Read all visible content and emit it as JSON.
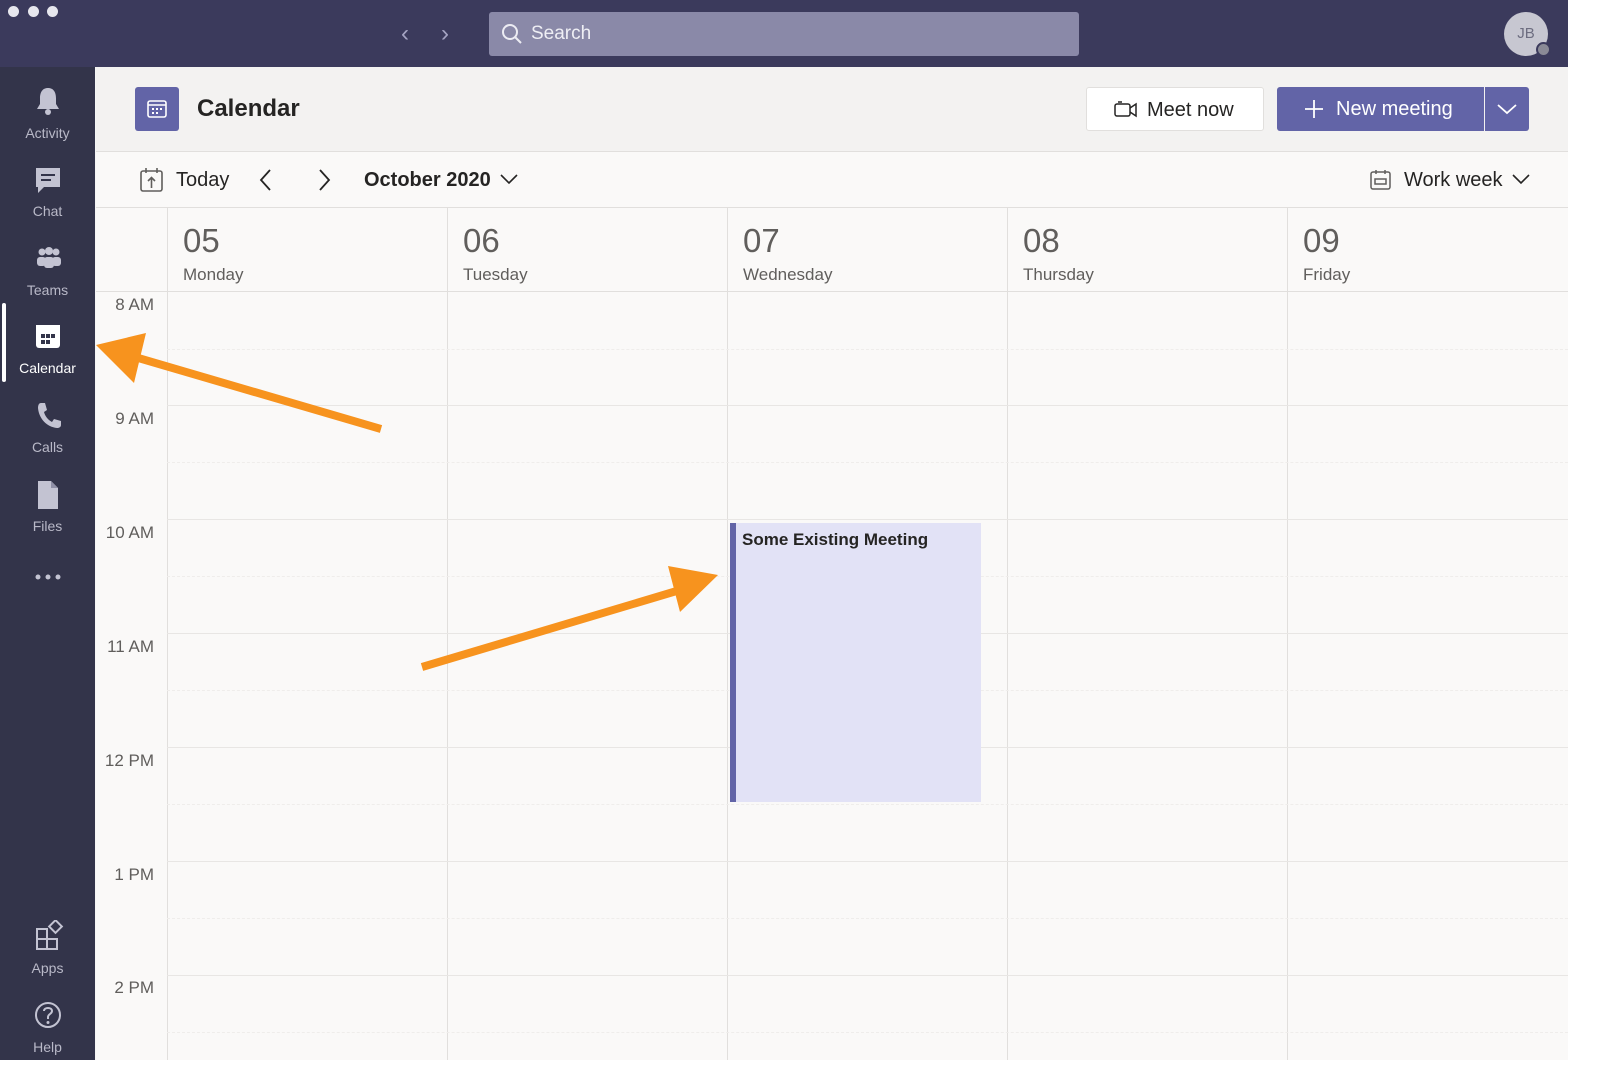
{
  "search": {
    "placeholder": "Search"
  },
  "user": {
    "initials": "JB"
  },
  "rail": {
    "items": [
      {
        "label": "Activity",
        "icon": "bell-icon"
      },
      {
        "label": "Chat",
        "icon": "chat-icon"
      },
      {
        "label": "Teams",
        "icon": "teams-icon"
      },
      {
        "label": "Calendar",
        "icon": "calendar-icon",
        "active": true
      },
      {
        "label": "Calls",
        "icon": "phone-icon"
      },
      {
        "label": "Files",
        "icon": "file-icon"
      }
    ],
    "bottom": [
      {
        "label": "Apps",
        "icon": "apps-icon"
      },
      {
        "label": "Help",
        "icon": "help-icon"
      }
    ]
  },
  "header": {
    "title": "Calendar",
    "meet_now": "Meet now",
    "new_meeting": "New meeting"
  },
  "toolbar": {
    "today": "Today",
    "month": "October 2020",
    "view": "Work week"
  },
  "days": [
    {
      "num": "05",
      "name": "Monday"
    },
    {
      "num": "06",
      "name": "Tuesday"
    },
    {
      "num": "07",
      "name": "Wednesday"
    },
    {
      "num": "08",
      "name": "Thursday"
    },
    {
      "num": "09",
      "name": "Friday"
    }
  ],
  "times": [
    "8 AM",
    "9 AM",
    "10 AM",
    "11 AM",
    "12 PM",
    "1 PM",
    "2 PM"
  ],
  "events": [
    {
      "title": "Some Existing Meeting",
      "day": "07"
    }
  ],
  "colors": {
    "brand": "#6264a7",
    "titlebar": "#3b3a5c",
    "rail": "#33344a",
    "event_fill": "#e2e2f6",
    "annotation_arrow": "#f7931e"
  }
}
